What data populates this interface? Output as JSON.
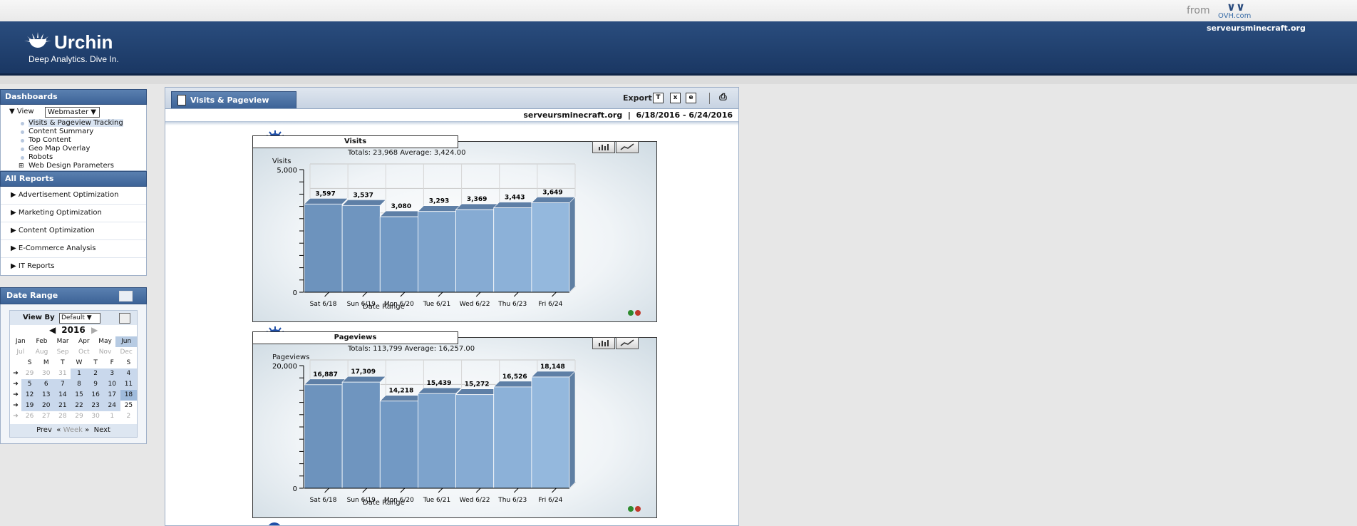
{
  "header": {
    "from_label": "from",
    "ovh_label": "OVH.com",
    "logo_name": "Urchin",
    "logo_tagline": "Deep Analytics. Dive In.",
    "site": "serveursminecraft.org"
  },
  "sidebar": {
    "dashboards_title": "Dashboards",
    "view_label": "View",
    "view_value": "Webmaster",
    "dashboard_items": [
      "Visits & Pageview Tracking",
      "Content Summary",
      "Top Content",
      "Geo Map Overlay",
      "Robots",
      "Web Design Parameters"
    ],
    "all_reports_title": "All Reports",
    "report_items": [
      "Advertisement Optimization",
      "Marketing Optimization",
      "Content Optimization",
      "E-Commerce Analysis",
      "IT Reports"
    ]
  },
  "date_range": {
    "title": "Date Range",
    "view_by_label": "View By",
    "view_by_value": "Default",
    "year": "2016",
    "months": [
      "Jan",
      "Feb",
      "Mar",
      "Apr",
      "May",
      "Jun",
      "Jul",
      "Aug",
      "Sep",
      "Oct",
      "Nov",
      "Dec"
    ],
    "weekday_headers": [
      "S",
      "M",
      "T",
      "W",
      "T",
      "F",
      "S"
    ],
    "weeks": [
      [
        "29",
        "30",
        "31",
        "1",
        "2",
        "3",
        "4"
      ],
      [
        "5",
        "6",
        "7",
        "8",
        "9",
        "10",
        "11"
      ],
      [
        "12",
        "13",
        "14",
        "15",
        "16",
        "17",
        "18"
      ],
      [
        "19",
        "20",
        "21",
        "22",
        "23",
        "24",
        "25"
      ],
      [
        "26",
        "27",
        "28",
        "29",
        "30",
        "1",
        "2"
      ]
    ],
    "nav_prev": "Prev",
    "nav_week": "Week",
    "nav_next": "Next"
  },
  "report": {
    "tab_title": "Visits & Pageview Tracking",
    "export_label": "Export",
    "site": "serveursminecraft.org",
    "range": "6/18/2016 - 6/24/2016"
  },
  "charts": [
    {
      "title": "Visits",
      "totals_text": "Totals: 23,968   Average: 3,424.00",
      "ylabel": "Visits",
      "xlabel": "Date Range",
      "ymax_label": "5,000",
      "ymin_label": "0",
      "value_labels": [
        "3,597",
        "3,537",
        "3,080",
        "3,293",
        "3,369",
        "3,443",
        "3,649"
      ]
    },
    {
      "title": "Pageviews",
      "totals_text": "Totals: 113,799   Average: 16,257.00",
      "ylabel": "Pageviews",
      "xlabel": "Date Range",
      "ymax_label": "20,000",
      "ymin_label": "0",
      "value_labels": [
        "16,887",
        "17,309",
        "14,218",
        "15,439",
        "15,272",
        "16,526",
        "18,148"
      ]
    }
  ],
  "chart_data": [
    {
      "type": "bar",
      "title": "Visits",
      "categories": [
        "Sat 6/18",
        "Sun 6/19",
        "Mon 6/20",
        "Tue 6/21",
        "Wed 6/22",
        "Thu 6/23",
        "Fri 6/24"
      ],
      "values": [
        3597,
        3537,
        3080,
        3293,
        3369,
        3443,
        3649
      ],
      "ylabel": "Visits",
      "xlabel": "Date Range",
      "ylim": [
        0,
        5000
      ]
    },
    {
      "type": "bar",
      "title": "Pageviews",
      "categories": [
        "Sat 6/18",
        "Sun 6/19",
        "Mon 6/20",
        "Tue 6/21",
        "Wed 6/22",
        "Thu 6/23",
        "Fri 6/24"
      ],
      "values": [
        16887,
        17309,
        14218,
        15439,
        15272,
        16526,
        18148
      ],
      "ylabel": "Pageviews",
      "xlabel": "Date Range",
      "ylim": [
        0,
        20000
      ]
    }
  ]
}
